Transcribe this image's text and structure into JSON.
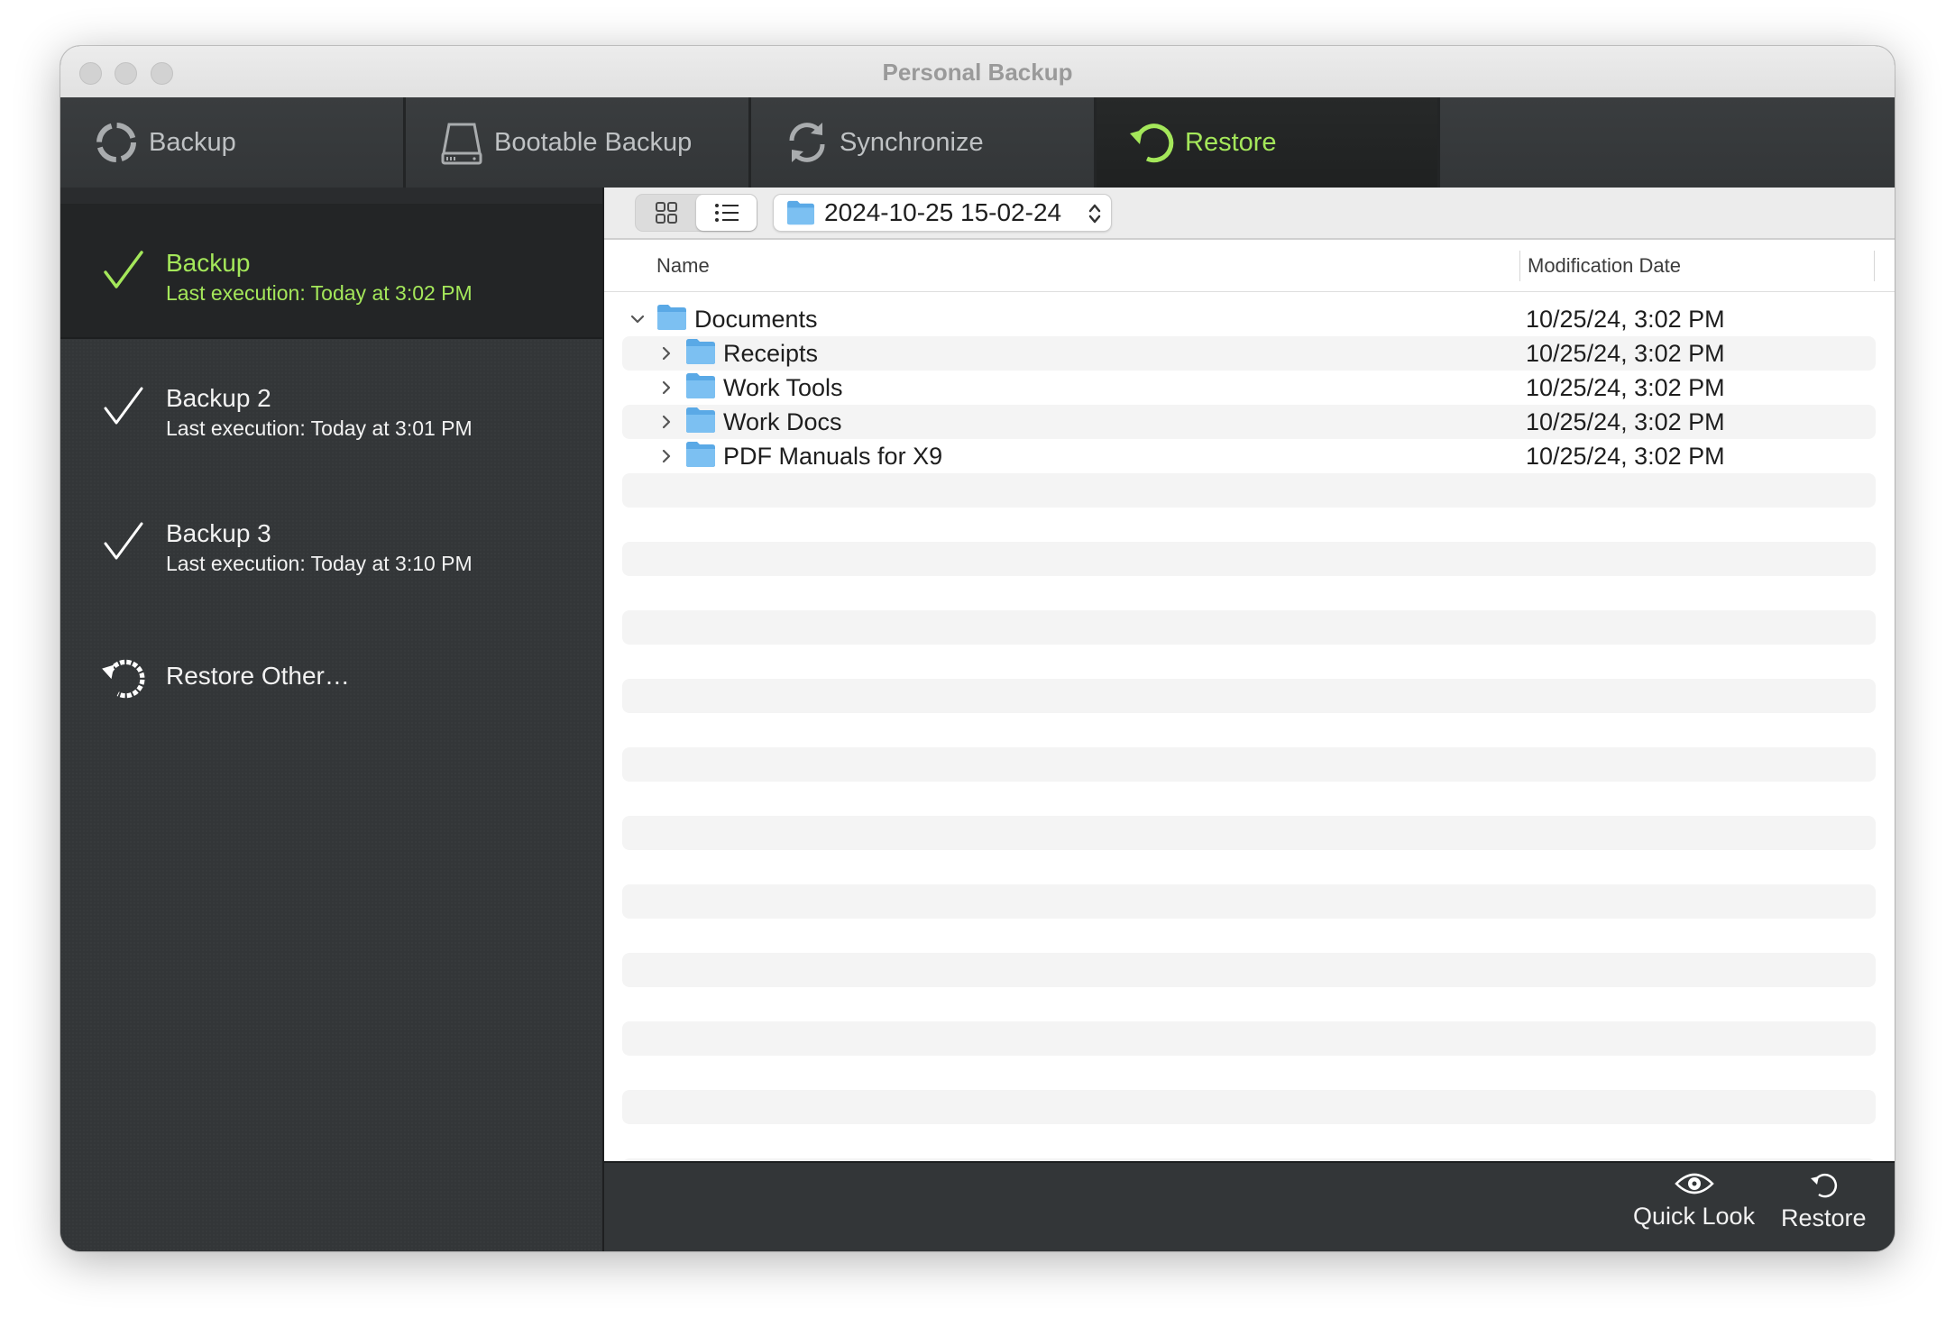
{
  "window": {
    "title": "Personal Backup"
  },
  "tabs": [
    {
      "label": "Backup",
      "icon": "backup-ring-icon",
      "active": false
    },
    {
      "label": "Bootable Backup",
      "icon": "drive-icon",
      "active": false
    },
    {
      "label": "Synchronize",
      "icon": "sync-arrows-icon",
      "active": false
    },
    {
      "label": "Restore",
      "icon": "restore-arrow-icon",
      "active": true
    }
  ],
  "sidebar": {
    "items": [
      {
        "name": "Backup",
        "sub": "Last execution: Today at 3:02 PM",
        "selected": true
      },
      {
        "name": "Backup 2",
        "sub": "Last execution: Today at 3:01 PM",
        "selected": false
      },
      {
        "name": "Backup 3",
        "sub": "Last execution: Today at 3:10 PM",
        "selected": false
      }
    ],
    "restore_other": "Restore Other…"
  },
  "toolbar": {
    "snapshot": "2024-10-25 15-02-24"
  },
  "columns": {
    "name": "Name",
    "date": "Modification Date"
  },
  "rows": [
    {
      "name": "Documents",
      "date": "10/25/24, 3:02 PM",
      "level": 0,
      "expanded": true
    },
    {
      "name": "Receipts",
      "date": "10/25/24, 3:02 PM",
      "level": 1,
      "expanded": false
    },
    {
      "name": "Work Tools",
      "date": "10/25/24, 3:02 PM",
      "level": 1,
      "expanded": false
    },
    {
      "name": "Work Docs",
      "date": "10/25/24, 3:02 PM",
      "level": 1,
      "expanded": false
    },
    {
      "name": "PDF Manuals for X9",
      "date": "10/25/24, 3:02 PM",
      "level": 1,
      "expanded": false
    }
  ],
  "bottom": {
    "quicklook": "Quick Look",
    "restore": "Restore"
  },
  "colors": {
    "accent": "#a4e75a",
    "folder": "#6fb8ef"
  }
}
